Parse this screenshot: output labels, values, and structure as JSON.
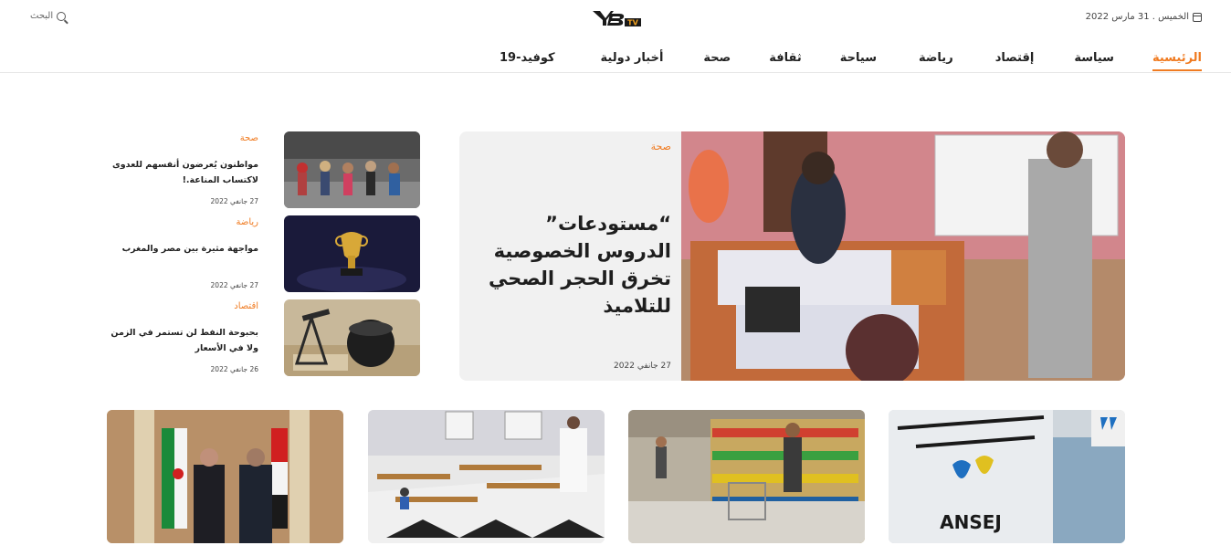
{
  "header": {
    "date": "الخميس . 31 مارس 2022",
    "search_label": "البحث",
    "logo_text": "TV"
  },
  "nav": {
    "items": [
      {
        "label": "الرئيسية",
        "active": true
      },
      {
        "label": "سياسة"
      },
      {
        "label": "إقتصاد"
      },
      {
        "label": "رياضة"
      },
      {
        "label": "سياحة"
      },
      {
        "label": "ثقافة"
      },
      {
        "label": "صحة"
      },
      {
        "label": "أخبار دولية"
      },
      {
        "label": "كوفيد-19"
      }
    ]
  },
  "hero": {
    "category": "صحة",
    "title": "“مستودعات” الدروس الخصوصية تخرق الحجر الصحي للتلاميذ",
    "date": "27 جانفي 2022"
  },
  "side": [
    {
      "category": "صحة",
      "title": "مواطنون يُعرضون أنفسهم للعدوى لاكتساب المناعة.!",
      "date": "27 جانفي 2022"
    },
    {
      "category": "رياضة",
      "title": "مواجهة مثيرة بين مصر والمغرب",
      "date": "27 جانفي 2022"
    },
    {
      "category": "اقتصاد",
      "title": "بحبوحة النفط لن تستمر في الزمن ولا في الأسعار",
      "date": "26 جانفي 2022"
    }
  ],
  "cards": [
    {
      "image": "ansej-building"
    },
    {
      "image": "supermarket-shoppers"
    },
    {
      "image": "classroom-students"
    },
    {
      "image": "presidents-meeting"
    }
  ],
  "colors": {
    "accent": "#f07b21"
  }
}
